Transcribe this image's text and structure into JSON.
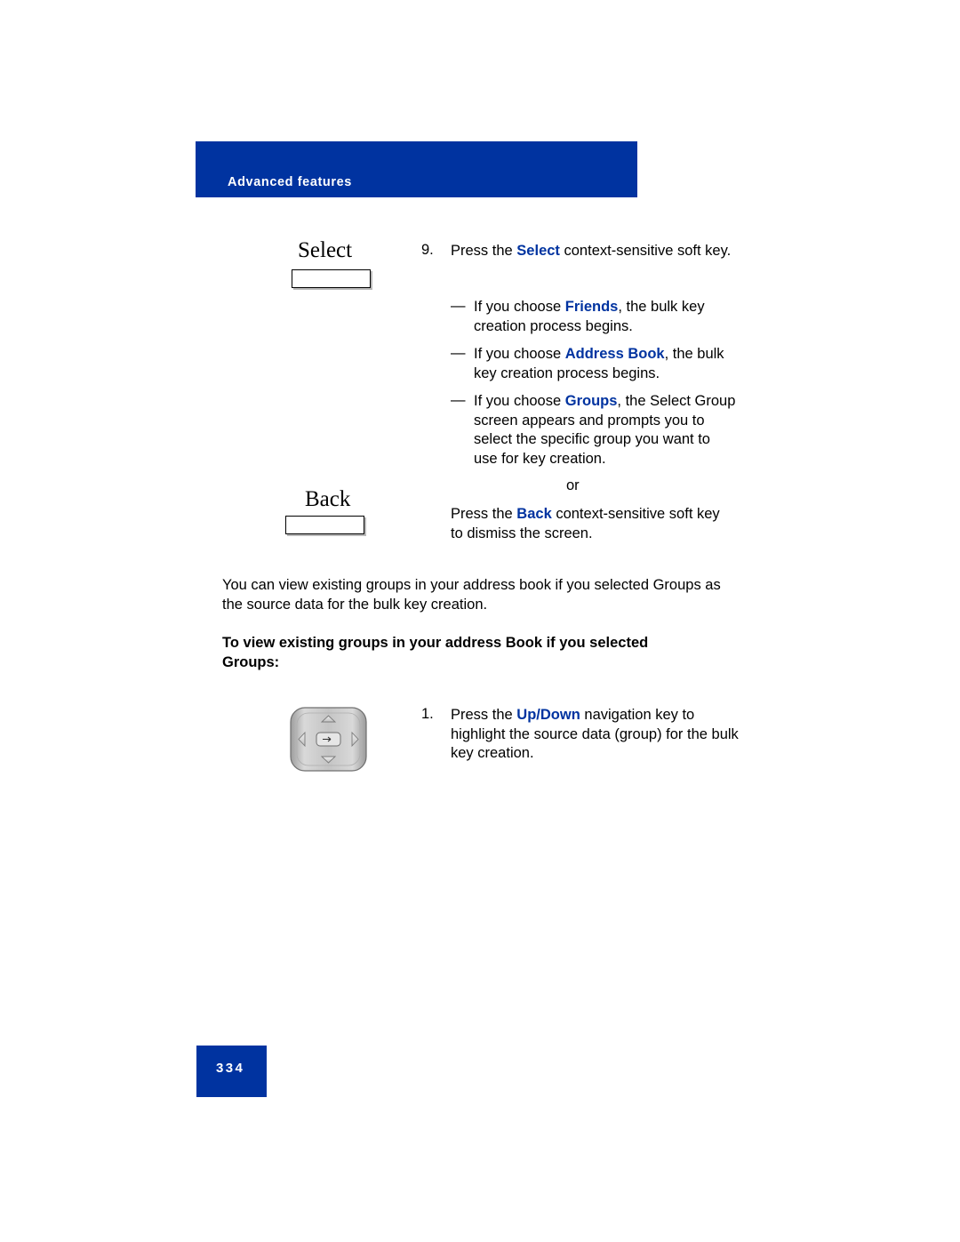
{
  "header": {
    "title": "Advanced features",
    "bg_color": "#0033a0"
  },
  "softkeys": [
    {
      "name": "select",
      "label": "Select"
    },
    {
      "name": "back",
      "label": "Back"
    }
  ],
  "steps": {
    "step9": {
      "number": "9.",
      "text_before": "Press the ",
      "keyword": "Select",
      "text_after": " context-sensitive soft key."
    },
    "step1": {
      "number": "1.",
      "text_before": "Press the ",
      "keyword_up": "Up",
      "separator": "/",
      "keyword_down": "Down",
      "text_after": " navigation key to highlight the source data (group) for the bulk key creation."
    }
  },
  "bullets": [
    {
      "mark": "—",
      "text_before": "If you choose ",
      "keyword": "Friends",
      "text_after": ", the bulk key creation process begins."
    },
    {
      "mark": "—",
      "text_before": "If you choose ",
      "keyword": "Address Book",
      "text_after": ", the bulk key creation process begins."
    },
    {
      "mark": "—",
      "text_before": "If you choose ",
      "keyword": "Groups",
      "text_after": ", the Select Group screen appears and prompts you to select the specific group you want to use for key creation."
    }
  ],
  "or_text": "or",
  "back_step": {
    "text_before": "Press the ",
    "keyword": "Back",
    "text_after": " context-sensitive soft key to dismiss the screen."
  },
  "paragraph": "You can view existing groups in your address book if you selected Groups as the source data for the bulk key creation.",
  "heading": "To view existing groups in your address Book if you selected Groups:",
  "footer": {
    "page_number": "334"
  },
  "colors": {
    "accent_blue": "#0033a0",
    "keyword_blue": "#0033a0"
  }
}
